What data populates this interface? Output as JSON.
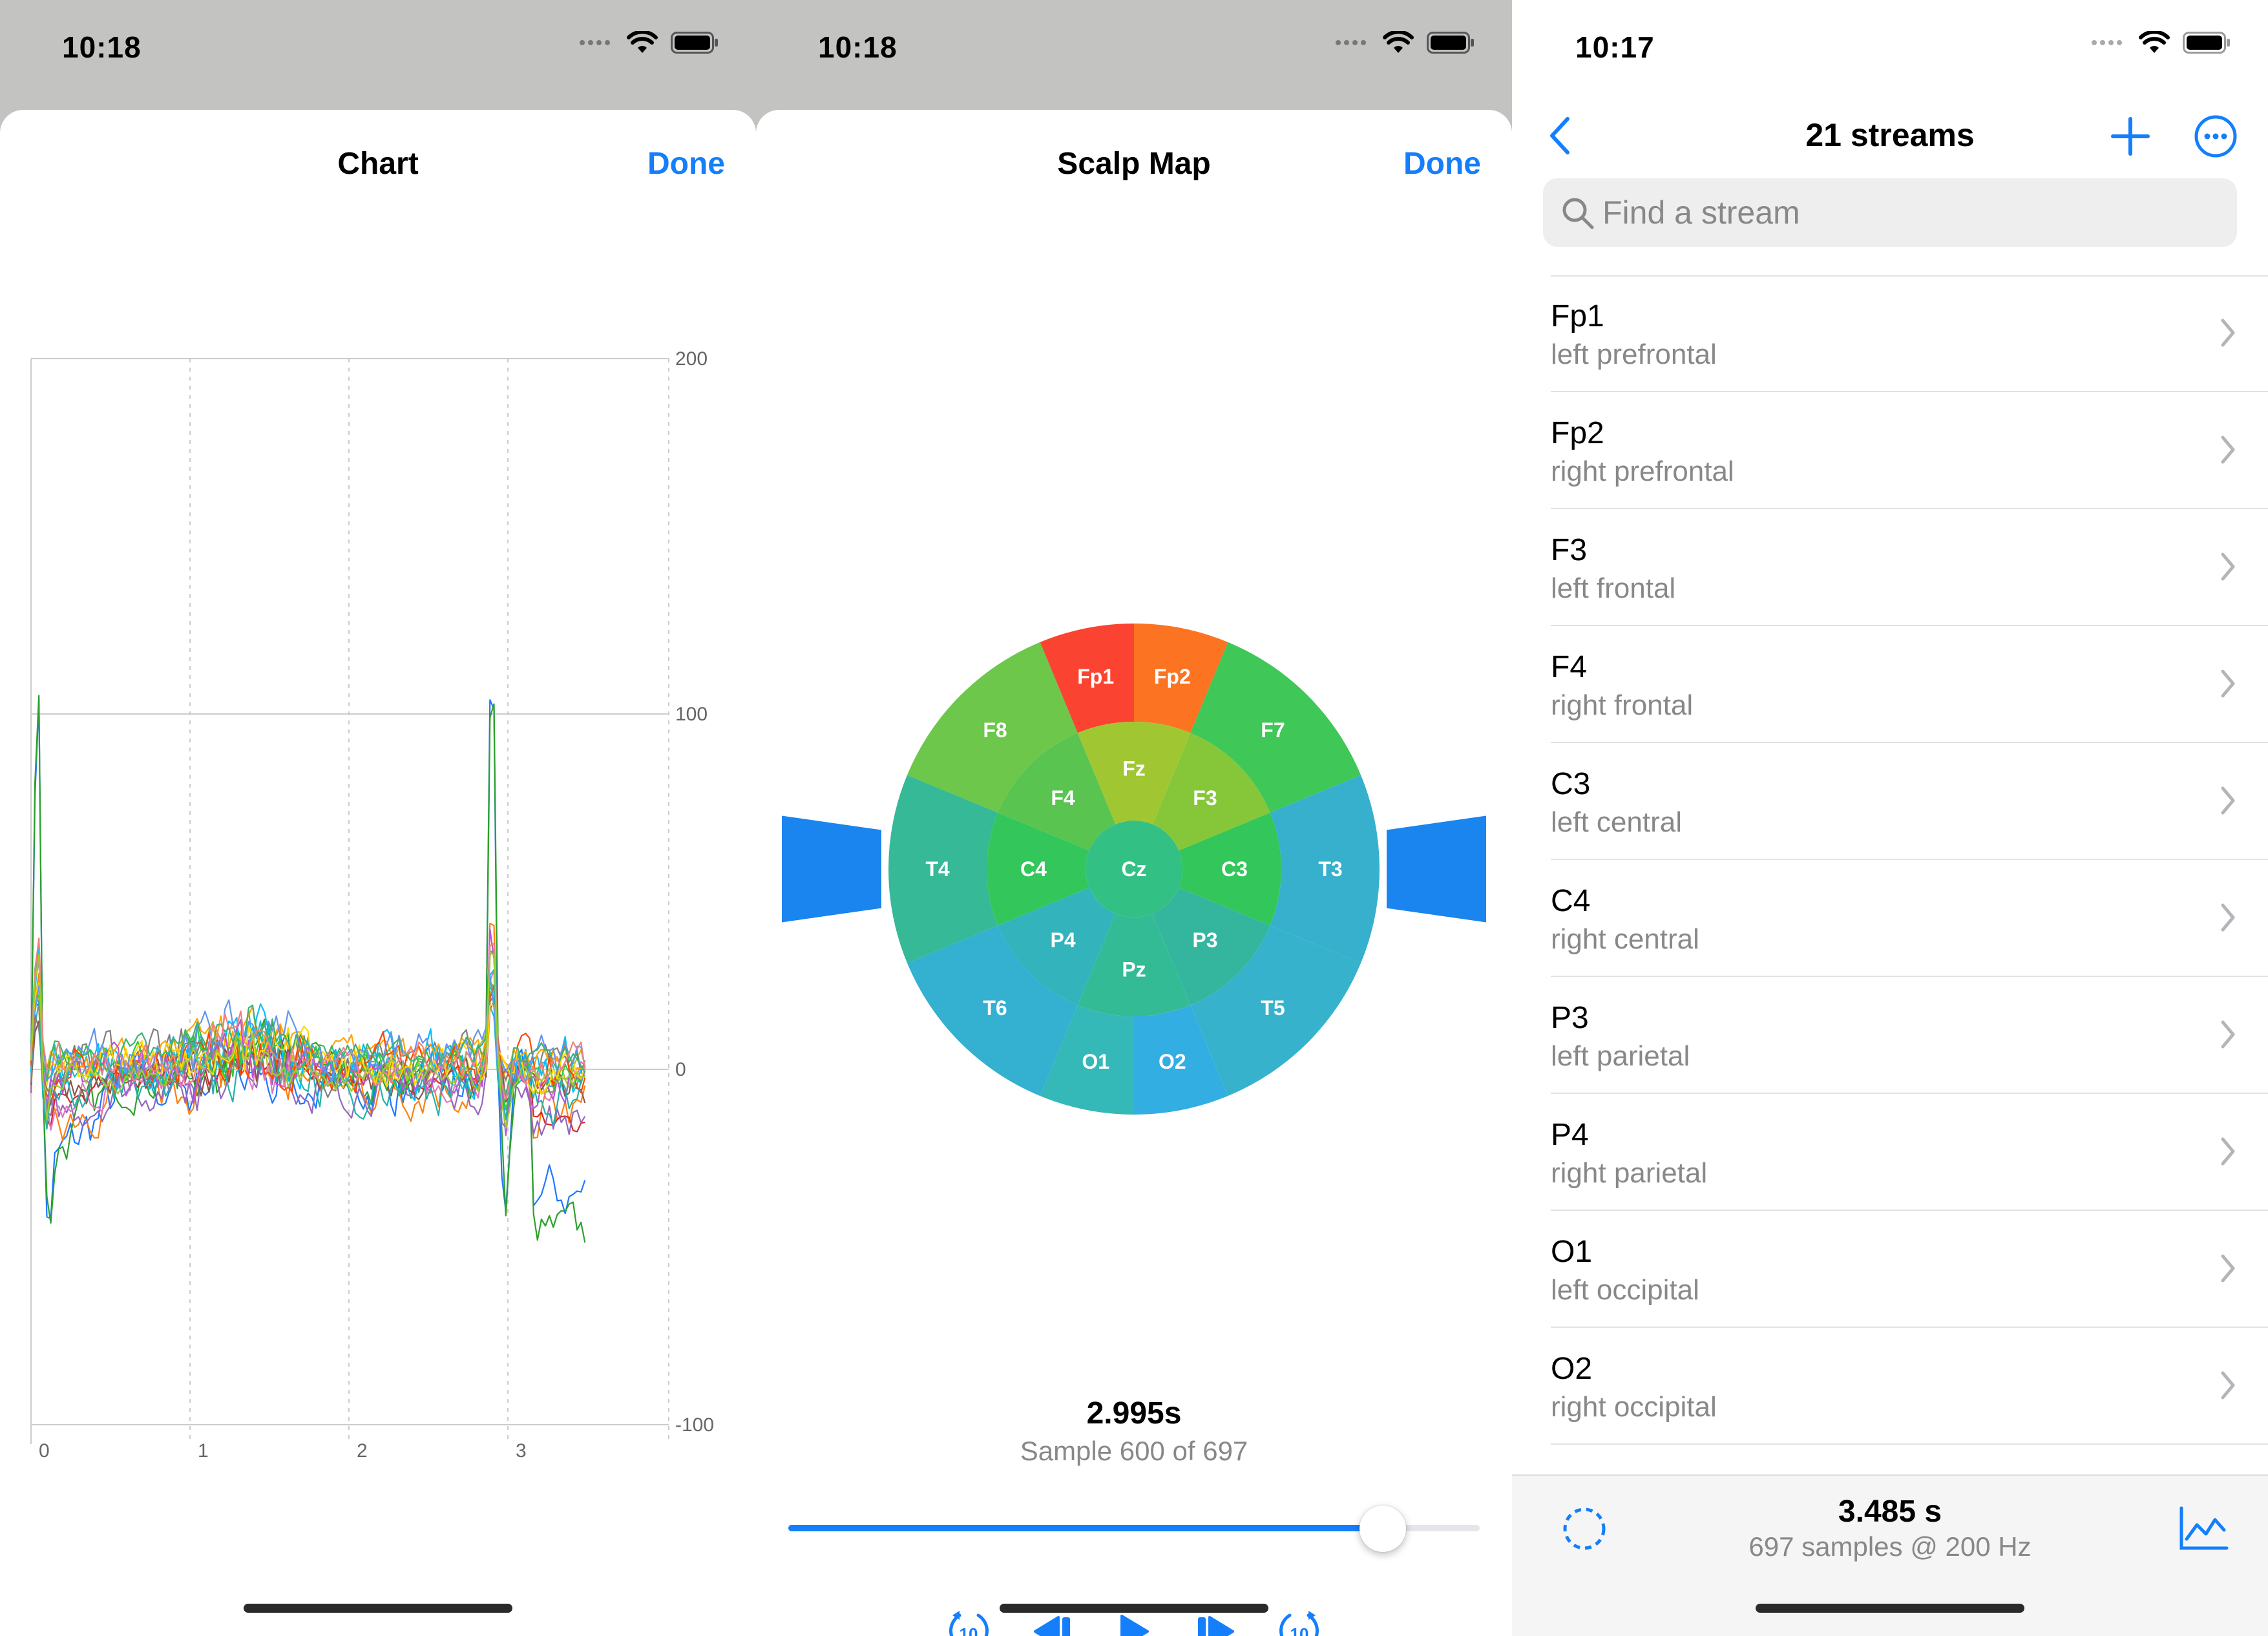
{
  "colors": {
    "accent": "#157efb",
    "status_bg": "#c3c4c2",
    "separator": "#e2e2e4",
    "secondary_text": "#888888"
  },
  "chart_panel": {
    "status": {
      "time": "10:18"
    },
    "title": "Chart",
    "done_label": "Done",
    "chart_data": {
      "type": "line",
      "title": "",
      "xlabel": "",
      "ylabel": "",
      "x_ticks": [
        "0",
        "1",
        "2",
        "3"
      ],
      "y_ticks": [
        "200",
        "100",
        "0",
        "-100"
      ],
      "xlim": [
        0,
        3.485
      ],
      "ylim": [
        -100,
        200
      ],
      "grid": true,
      "y_axis_side": "right",
      "series_count": 21,
      "series_colors": [
        "#1f77ff",
        "#2ca02c",
        "#ff7f0e",
        "#d62728",
        "#9467bd",
        "#e377c2",
        "#17becf",
        "#bcbd22",
        "#8c564b",
        "#7f7f7f",
        "#00bfff",
        "#32cd32",
        "#ffa500",
        "#ff4500",
        "#ba55d3",
        "#20b2aa",
        "#ffd700",
        "#6495ed",
        "#3cb371",
        "#f08080",
        "#9acd32"
      ],
      "features": {
        "spike_1": {
          "x": 0.04,
          "peak": 128,
          "trough": -58
        },
        "spike_2": {
          "x": 2.9,
          "peak": 137,
          "trough": -56
        },
        "end_drift": {
          "x_start": 3.15,
          "values": [
            -30,
            -45
          ]
        },
        "baseline_noise_range": [
          -30,
          30
        ]
      }
    }
  },
  "scalp_panel": {
    "status": {
      "time": "10:18"
    },
    "title": "Scalp Map",
    "done_label": "Done",
    "regions": {
      "Fp1": {
        "color": "#fa4431"
      },
      "Fp2": {
        "color": "#fc7322"
      },
      "F8": {
        "color": "#6cc74b"
      },
      "F7": {
        "color": "#3fc758"
      },
      "T4": {
        "color": "#35b996"
      },
      "T3": {
        "color": "#36b0cd"
      },
      "T6": {
        "color": "#34b0d1"
      },
      "T5": {
        "color": "#36b2cc"
      },
      "O1": {
        "color": "#35b8b8"
      },
      "O2": {
        "color": "#33aee2"
      },
      "A2": {
        "color": "#1a84ef"
      },
      "A1": {
        "color": "#1a84ef"
      },
      "F4": {
        "color": "#59c450"
      },
      "Fz": {
        "color": "#a0c732"
      },
      "F3": {
        "color": "#86c73a"
      },
      "C4": {
        "color": "#33c65a"
      },
      "C3": {
        "color": "#33c65a"
      },
      "P4": {
        "color": "#33b3bb"
      },
      "P3": {
        "color": "#34b69e"
      },
      "Pz": {
        "color": "#33bb96"
      },
      "Cz": {
        "color": "#33c085"
      }
    },
    "time_readout": "2.995s",
    "sample_readout": "Sample 600 of 697",
    "slider_value": 0.86,
    "controls": {
      "skip_back_label": "10",
      "skip_forward_label": "10"
    }
  },
  "streams_panel": {
    "status": {
      "time": "10:17"
    },
    "title": "21 streams",
    "search": {
      "placeholder": "Find a stream",
      "value": ""
    },
    "items": [
      {
        "name": "Fp1",
        "desc": "left prefrontal"
      },
      {
        "name": "Fp2",
        "desc": "right prefrontal"
      },
      {
        "name": "F3",
        "desc": "left frontal"
      },
      {
        "name": "F4",
        "desc": "right frontal"
      },
      {
        "name": "C3",
        "desc": "left central"
      },
      {
        "name": "C4",
        "desc": "right central"
      },
      {
        "name": "P3",
        "desc": "left parietal"
      },
      {
        "name": "P4",
        "desc": "right parietal"
      },
      {
        "name": "O1",
        "desc": "left occipital"
      },
      {
        "name": "O2",
        "desc": "right occipital"
      }
    ],
    "bottom": {
      "duration": "3.485 s",
      "info": "697 samples @ 200 Hz"
    }
  }
}
